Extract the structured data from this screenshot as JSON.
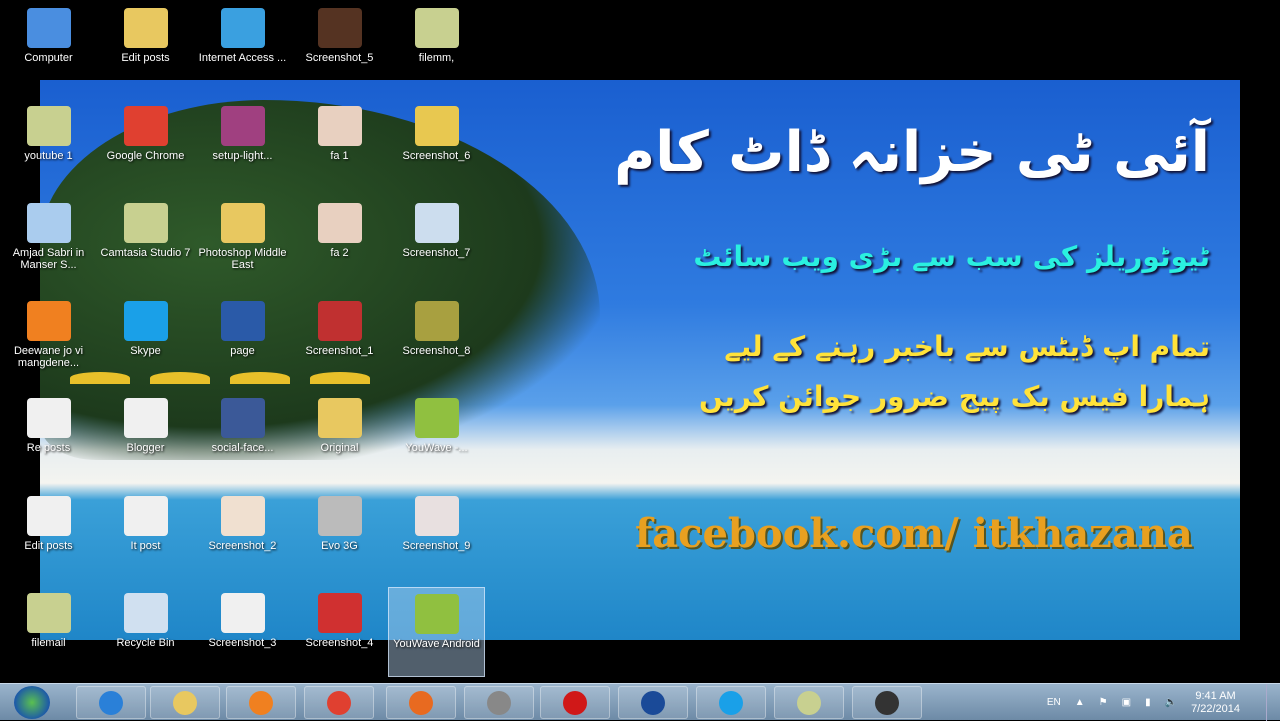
{
  "wallpaper": {
    "title": "آئی ٹی خزانہ ڈاٹ کام",
    "subtitle": "ٹیوٹوریلز کی سب سے بڑی ویب سائٹ",
    "line3": "تمام اپ ڈیٹس سے باخبر رہنے کے لیے",
    "line4": "ہمارا فیس بک پیج ضرور جوائن کریں",
    "facebook": "facebook.com/ itkhazana"
  },
  "icons": [
    {
      "label": "Computer",
      "color": "#4a8ee0"
    },
    {
      "label": "Edit posts",
      "color": "#e8c860"
    },
    {
      "label": "Internet Access ...",
      "color": "#3aa0e0"
    },
    {
      "label": "Screenshot_5",
      "color": "#553322"
    },
    {
      "label": "filemm,",
      "color": "#c8d090"
    },
    {
      "label": "youtube 1",
      "color": "#c8d090"
    },
    {
      "label": "Google Chrome",
      "color": "#e04030"
    },
    {
      "label": "setup-light...",
      "color": "#a04080"
    },
    {
      "label": "fa 1",
      "color": "#e8d0c0"
    },
    {
      "label": "Screenshot_6",
      "color": "#e8c850"
    },
    {
      "label": "Amjad Sabri in Manser S...",
      "color": "#aaccee"
    },
    {
      "label": "Camtasia Studio 7",
      "color": "#c8d090"
    },
    {
      "label": "Photoshop Middle East",
      "color": "#e8c860"
    },
    {
      "label": "fa 2",
      "color": "#e8d0c0"
    },
    {
      "label": "Screenshot_7",
      "color": "#ccddee"
    },
    {
      "label": "Deewane jo vi mangdene...",
      "color": "#f08020"
    },
    {
      "label": "Skype",
      "color": "#1aa0e8"
    },
    {
      "label": "page",
      "color": "#2a5aa8"
    },
    {
      "label": "Screenshot_1",
      "color": "#c03030"
    },
    {
      "label": "Screenshot_8",
      "color": "#a8a040"
    },
    {
      "label": "Re posts",
      "color": "#f0f0f0"
    },
    {
      "label": "Blogger",
      "color": "#f0f0f0"
    },
    {
      "label": "social-face...",
      "color": "#3b5998"
    },
    {
      "label": "Original",
      "color": "#e8c860"
    },
    {
      "label": "YouWave -...",
      "color": "#90c040"
    },
    {
      "label": "Edit posts",
      "color": "#f0f0f0"
    },
    {
      "label": "It post",
      "color": "#f0f0f0"
    },
    {
      "label": "Screenshot_2",
      "color": "#f0e0d0"
    },
    {
      "label": "Evo 3G",
      "color": "#bbbbbb"
    },
    {
      "label": "Screenshot_9",
      "color": "#e8e0e0"
    },
    {
      "label": "filemail",
      "color": "#c8d090"
    },
    {
      "label": "Recycle Bin",
      "color": "#d0e0f0"
    },
    {
      "label": "Screenshot_3",
      "color": "#f0f0f0"
    },
    {
      "label": "Screenshot_4",
      "color": "#d03030"
    },
    {
      "label": "YouWave Android",
      "color": "#90c040"
    }
  ],
  "taskbar": {
    "apps": [
      {
        "name": "internet-explorer",
        "color": "#2a80d8"
      },
      {
        "name": "windows-explorer",
        "color": "#e8c860"
      },
      {
        "name": "media-player",
        "color": "#f08020"
      },
      {
        "name": "chrome",
        "color": "#e04030"
      },
      {
        "name": "firefox",
        "color": "#e86a20"
      },
      {
        "name": "camtasia",
        "color": "#888888"
      },
      {
        "name": "opera",
        "color": "#d01818"
      },
      {
        "name": "photoshop",
        "color": "#1a4a98"
      },
      {
        "name": "skype",
        "color": "#1aa0e8"
      },
      {
        "name": "camtasia-studio",
        "color": "#c8d090"
      },
      {
        "name": "camera",
        "color": "#333333"
      }
    ],
    "language": "EN",
    "time": "9:41 AM",
    "date": "7/22/2014"
  }
}
